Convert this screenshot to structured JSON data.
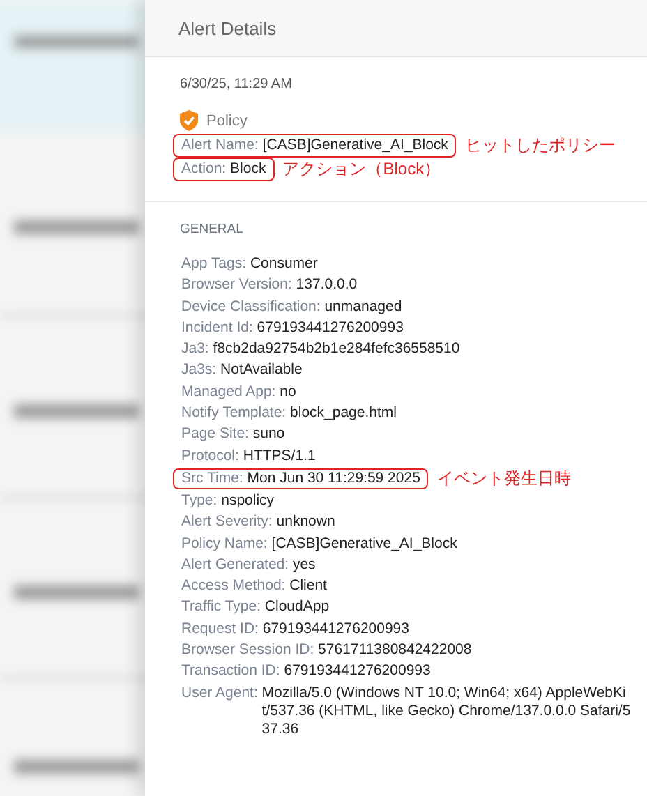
{
  "panel": {
    "title": "Alert Details",
    "timestamp": "6/30/25, 11:29 AM",
    "category": "Policy",
    "summary": [
      {
        "label": "Alert Name:",
        "value": "[CASB]Generative_AI_Block",
        "highlighted": true,
        "annotation": "ヒットしたポリシー"
      },
      {
        "label": "Action:",
        "value": "Block",
        "highlighted": true,
        "annotation": "アクション（Block）"
      }
    ]
  },
  "general": {
    "heading": "GENERAL",
    "fields": [
      {
        "label": "App Tags:",
        "value": "Consumer",
        "highlighted": false
      },
      {
        "label": "Browser Version:",
        "value": "137.0.0.0",
        "highlighted": false
      },
      {
        "label": "Device Classification:",
        "value": "unmanaged",
        "highlighted": false
      },
      {
        "label": "Incident Id:",
        "value": "679193441276200993",
        "highlighted": false
      },
      {
        "label": "Ja3:",
        "value": "f8cb2da92754b2b1e284fefc36558510",
        "highlighted": false
      },
      {
        "label": "Ja3s:",
        "value": "NotAvailable",
        "highlighted": false
      },
      {
        "label": "Managed App:",
        "value": "no",
        "highlighted": false
      },
      {
        "label": "Notify Template:",
        "value": "block_page.html",
        "highlighted": false
      },
      {
        "label": "Page Site:",
        "value": "suno",
        "highlighted": false
      },
      {
        "label": "Protocol:",
        "value": "HTTPS/1.1",
        "highlighted": false
      },
      {
        "label": "Src Time:",
        "value": "Mon Jun 30 11:29:59 2025",
        "highlighted": true,
        "annotation": "イベント発生日時"
      },
      {
        "label": "Type:",
        "value": "nspolicy",
        "highlighted": false
      },
      {
        "label": "Alert Severity:",
        "value": "unknown",
        "highlighted": false
      },
      {
        "label": "Policy Name:",
        "value": "[CASB]Generative_AI_Block",
        "highlighted": false
      },
      {
        "label": "Alert Generated:",
        "value": "yes",
        "highlighted": false
      },
      {
        "label": "Access Method:",
        "value": "Client",
        "highlighted": false
      },
      {
        "label": "Traffic Type:",
        "value": "CloudApp",
        "highlighted": false
      },
      {
        "label": "Request ID:",
        "value": "679193441276200993",
        "highlighted": false
      },
      {
        "label": "Browser Session ID:",
        "value": "5761711380842422008",
        "highlighted": false
      },
      {
        "label": "Transaction ID:",
        "value": "679193441276200993",
        "highlighted": false
      },
      {
        "label": "User Agent:",
        "value": "Mozilla/5.0 (Windows NT 10.0; Win64; x64) AppleWebKit/537.36 (KHTML, like Gecko) Chrome/137.0.0.0 Safari/537.36",
        "highlighted": false
      }
    ]
  }
}
